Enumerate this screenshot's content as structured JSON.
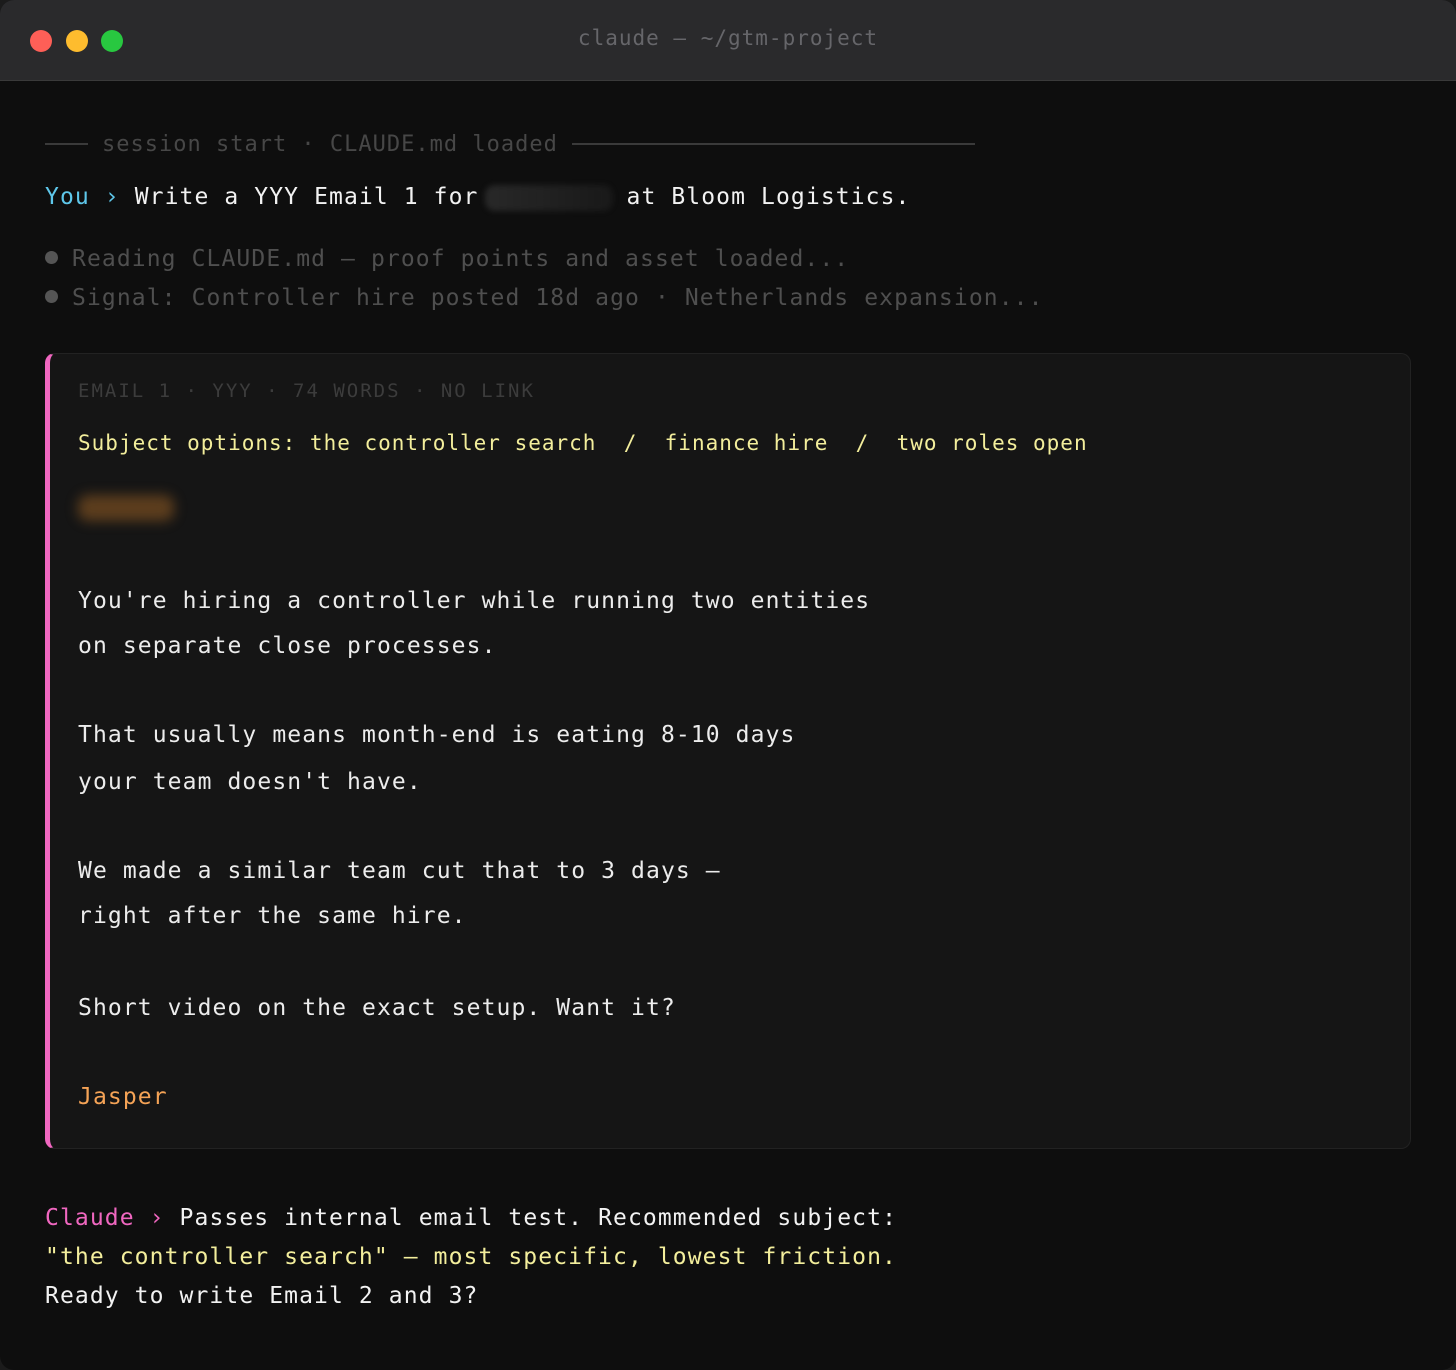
{
  "window": {
    "title": "claude — ~/gtm-project"
  },
  "session": {
    "label": "session start · CLAUDE.md loaded"
  },
  "prompt": {
    "speaker": "You",
    "chevron": "›",
    "text_before": "Write a YYY Email 1 for",
    "text_after": "at Bloom Logistics."
  },
  "status": [
    "Reading CLAUDE.md — proof points and asset loaded...",
    "Signal: Controller hire posted 18d ago · Netherlands expansion..."
  ],
  "email": {
    "meta": "EMAIL 1 · YYY · 74 WORDS · NO LINK",
    "subject": "Subject options: the controller search  /  finance hire  /  two roles open",
    "body": [
      "You're hiring a controller while running two entities",
      "on separate close processes.",
      "That usually means month-end is eating 8-10 days",
      "your team doesn't have.",
      "We made a similar team cut that to 3 days —",
      "right after the same hire.",
      "Short video on the exact setup. Want it?"
    ],
    "signoff": "Jasper"
  },
  "reply": {
    "speaker": "Claude",
    "chevron": "›",
    "line1": "Passes internal email test. Recommended subject:",
    "line2": "\"the controller search\" — most specific, lowest friction.",
    "line3": "Ready to write Email 2 and 3?"
  },
  "colors": {
    "user_accent": "#5ec7ea",
    "claude_accent": "#f067c0",
    "subject_yellow": "#f3ee9c",
    "signoff_orange": "#f5a356"
  }
}
